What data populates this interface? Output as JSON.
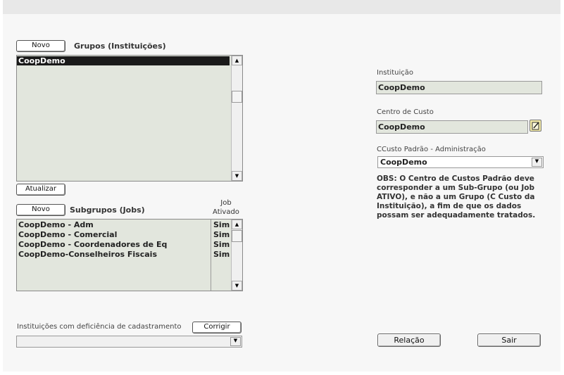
{
  "grupos": {
    "novo_label": "Novo",
    "title": "Grupos (Instituições)",
    "items": [
      "CoopDemo"
    ],
    "atualizar_label": "Atualizar"
  },
  "subgrupos": {
    "novo_label": "Novo",
    "title": "Subgrupos (Jobs)",
    "job_header_line1": "Job",
    "job_header_line2": "Ativado",
    "rows": [
      {
        "name": "CoopDemo - Adm",
        "ativo": "Sim"
      },
      {
        "name": "CoopDemo - Comercial",
        "ativo": "Sim"
      },
      {
        "name": "CoopDemo - Coordenadores de Eq",
        "ativo": "Sim"
      },
      {
        "name": "CoopDemo-Conselheiros Fiscais",
        "ativo": "Sim"
      }
    ]
  },
  "deficiencia": {
    "label": "Instituições com deficiência de cadastramento",
    "corrigir_label": "Corrigir",
    "selected": ""
  },
  "right": {
    "instituicao_label": "Instituição",
    "instituicao_value": "CoopDemo",
    "centro_label": "Centro de Custo",
    "centro_value": "CoopDemo",
    "ccusto_label": "CCusto Padrão - Administração",
    "ccusto_value": "CoopDemo",
    "obs": "OBS: O Centro de Custos Padrão deve corresponder a um Sub-Grupo (ou Job ATIVO), e não a um Grupo (C Custo da Instituição),  a fim de que os dados possam ser adequadamente tratados.",
    "relacao_label": "Relação",
    "sair_label": "Sair"
  },
  "colors": {
    "list_bg": "#e2e6dd",
    "selected_bg": "#1a1a1a",
    "panel_bg": "#f7f7f7"
  }
}
